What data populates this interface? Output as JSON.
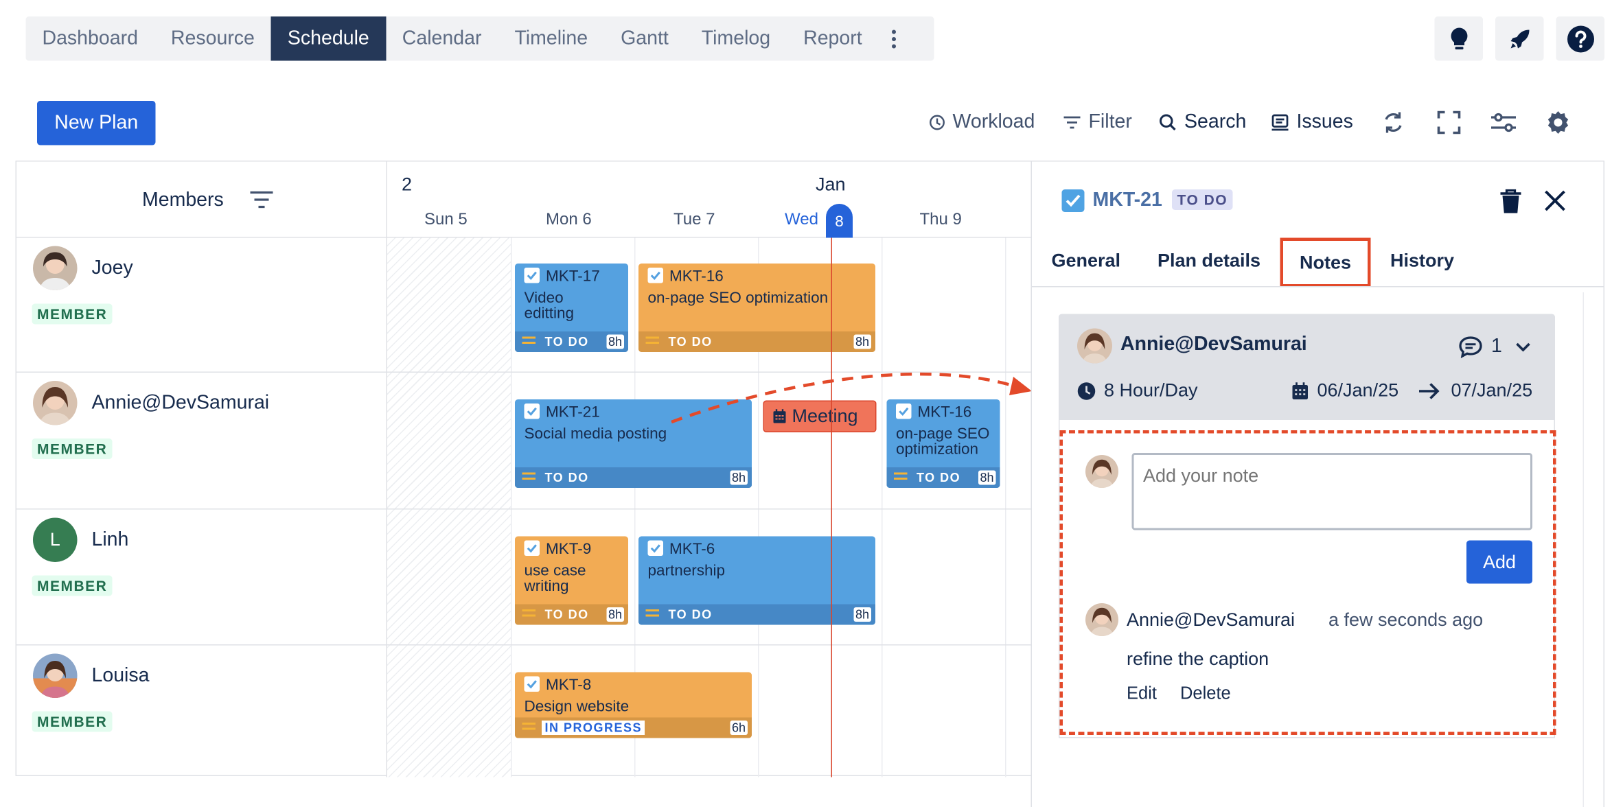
{
  "nav": {
    "tabs": [
      "Dashboard",
      "Resource",
      "Schedule",
      "Calendar",
      "Timeline",
      "Gantt",
      "Timelog",
      "Report"
    ],
    "active": "Schedule"
  },
  "toolbar": {
    "new_plan": "New Plan",
    "workload": "Workload",
    "filter": "Filter",
    "search": "Search",
    "issues": "Issues"
  },
  "schedule": {
    "members_label": "Members",
    "week_label": "2",
    "month_label": "Jan",
    "days": [
      {
        "name": "Sun",
        "num": "5"
      },
      {
        "name": "Mon",
        "num": "6"
      },
      {
        "name": "Tue",
        "num": "7"
      },
      {
        "name": "Wed",
        "num": "8"
      },
      {
        "name": "Thu",
        "num": "9"
      }
    ],
    "members": [
      {
        "name": "Joey",
        "role": "MEMBER",
        "initial": ""
      },
      {
        "name": "Annie@DevSamurai",
        "role": "MEMBER",
        "initial": ""
      },
      {
        "name": "Linh",
        "role": "MEMBER",
        "initial": "L"
      },
      {
        "name": "Louisa",
        "role": "MEMBER",
        "initial": ""
      }
    ],
    "tasks": [
      {
        "key": "MKT-17",
        "title": "Video editting",
        "status": "TO DO",
        "hours": "8h"
      },
      {
        "key": "MKT-16",
        "title": "on-page SEO optimization",
        "status": "TO DO",
        "hours": "8h"
      },
      {
        "key": "MKT-21",
        "title": "Social media posting",
        "status": "TO DO",
        "hours": "8h"
      },
      {
        "key": "MKT-16",
        "title": "on-page SEO optimization",
        "status": "TO DO",
        "hours": "8h"
      },
      {
        "key": "MKT-9",
        "title": "use case writing",
        "status": "TO DO",
        "hours": "8h"
      },
      {
        "key": "MKT-6",
        "title": "partnership",
        "status": "TO DO",
        "hours": "8h"
      },
      {
        "key": "MKT-8",
        "title": "Design website",
        "status": "IN PROGRESS",
        "hours": "6h"
      }
    ],
    "meeting": "Meeting"
  },
  "panel": {
    "issue_key": "MKT-21",
    "issue_status": "TO DO",
    "tabs": [
      "General",
      "Plan details",
      "Notes",
      "History"
    ],
    "active_tab": "Notes",
    "assignee": "Annie@DevSamurai",
    "comment_count": "1",
    "hours_per_day": "8 Hour/Day",
    "start_date": "06/Jan/25",
    "end_date": "07/Jan/25",
    "note_placeholder": "Add your note",
    "add_label": "Add",
    "note": {
      "author": "Annie@DevSamurai",
      "time": "a few seconds ago",
      "text": "refine the caption",
      "edit": "Edit",
      "delete": "Delete"
    }
  },
  "colors": {
    "primary": "#2563d9",
    "nav_active": "#253858",
    "task_blue": "#55a1e0",
    "task_orange": "#f2ab54",
    "meeting": "#f0745a",
    "today_line": "#d9442b",
    "highlight": "#e34a2a"
  }
}
